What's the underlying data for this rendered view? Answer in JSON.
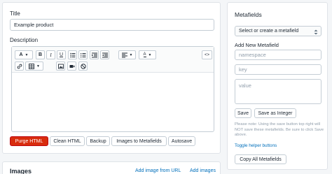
{
  "product": {
    "title_label": "Title",
    "title_value": "Example product",
    "description_label": "Description"
  },
  "toolbar": {
    "font_letter": "A",
    "bold": "B",
    "italic": "I",
    "underline": "U",
    "color_letter": "A",
    "code_view": "<>"
  },
  "actions": {
    "purge_html": "Purge HTML",
    "clean_html": "Clean HTML",
    "backup": "Backup",
    "images_to_metafields": "Images to Metafields",
    "autosave": "Autosave"
  },
  "images": {
    "heading": "Images",
    "add_from_url": "Add image from URL",
    "add_images": "Add images"
  },
  "metafields": {
    "heading": "Metafields",
    "select_value": "Select or create a metafield",
    "add_new_label": "Add New Metafield",
    "namespace_placeholder": "namespace",
    "key_placeholder": "key",
    "value_placeholder": "value",
    "save": "Save",
    "save_as_integer": "Save as Integer",
    "note": "Please note: Using the save button top right will NOT save these metafields. Be sure to click Save above.",
    "toggle_helper": "Toggle helper buttons",
    "copy_all": "Copy All Metafields"
  },
  "colors": {
    "danger": "#d82c0d",
    "link": "#006fbb",
    "border": "#c4cdd5",
    "background": "#f4f6f8"
  }
}
